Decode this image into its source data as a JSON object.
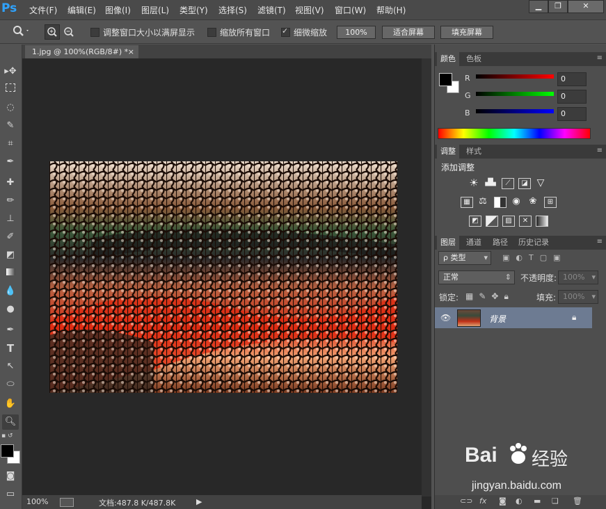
{
  "app": {
    "logo": "Ps"
  },
  "menu": [
    "文件(F)",
    "编辑(E)",
    "图像(I)",
    "图层(L)",
    "类型(Y)",
    "选择(S)",
    "滤镜(T)",
    "视图(V)",
    "窗口(W)",
    "帮助(H)"
  ],
  "window_buttons": {
    "minimize": "▁",
    "restore": "❐",
    "close": "✕"
  },
  "options": {
    "resize_windows_label": "调整窗口大小以满屏显示",
    "zoom_all_label": "缩放所有窗口",
    "scrubby_label": "细微缩放",
    "zoom_value": "100%",
    "fit_screen": "适合屏幕",
    "fill_screen": "填充屏幕"
  },
  "document": {
    "tab_title": "1.jpg @ 100%(RGB/8#) *",
    "close_glyph": "×",
    "status_zoom": "100%",
    "status_doc": "文档:487.8 K/487.8K",
    "status_arrow": "▶"
  },
  "color_panel": {
    "tabs": [
      "颜色",
      "色板"
    ],
    "r_label": "R",
    "g_label": "G",
    "b_label": "B",
    "r_value": "0",
    "g_value": "0",
    "b_value": "0",
    "foreground": "#000000",
    "background": "#ffffff"
  },
  "adjust_panel": {
    "tabs": [
      "调整",
      "样式"
    ],
    "title": "添加调整"
  },
  "layers_panel": {
    "tabs": [
      "图层",
      "通道",
      "路径",
      "历史记录"
    ],
    "filter_label": "ρ 类型",
    "blend_mode": "正常",
    "opacity_label": "不透明度:",
    "opacity_value": "100%",
    "lock_label": "锁定:",
    "fill_label": "填充:",
    "fill_value": "100%",
    "layer_name": "背景"
  },
  "watermark": {
    "brand": "Bai",
    "brand2": "经验",
    "url": "jingyan.baidu.com"
  },
  "icons": {
    "zoom_tool": "magnifier-icon",
    "eye": "eye-icon",
    "lock": "lock-icon"
  }
}
